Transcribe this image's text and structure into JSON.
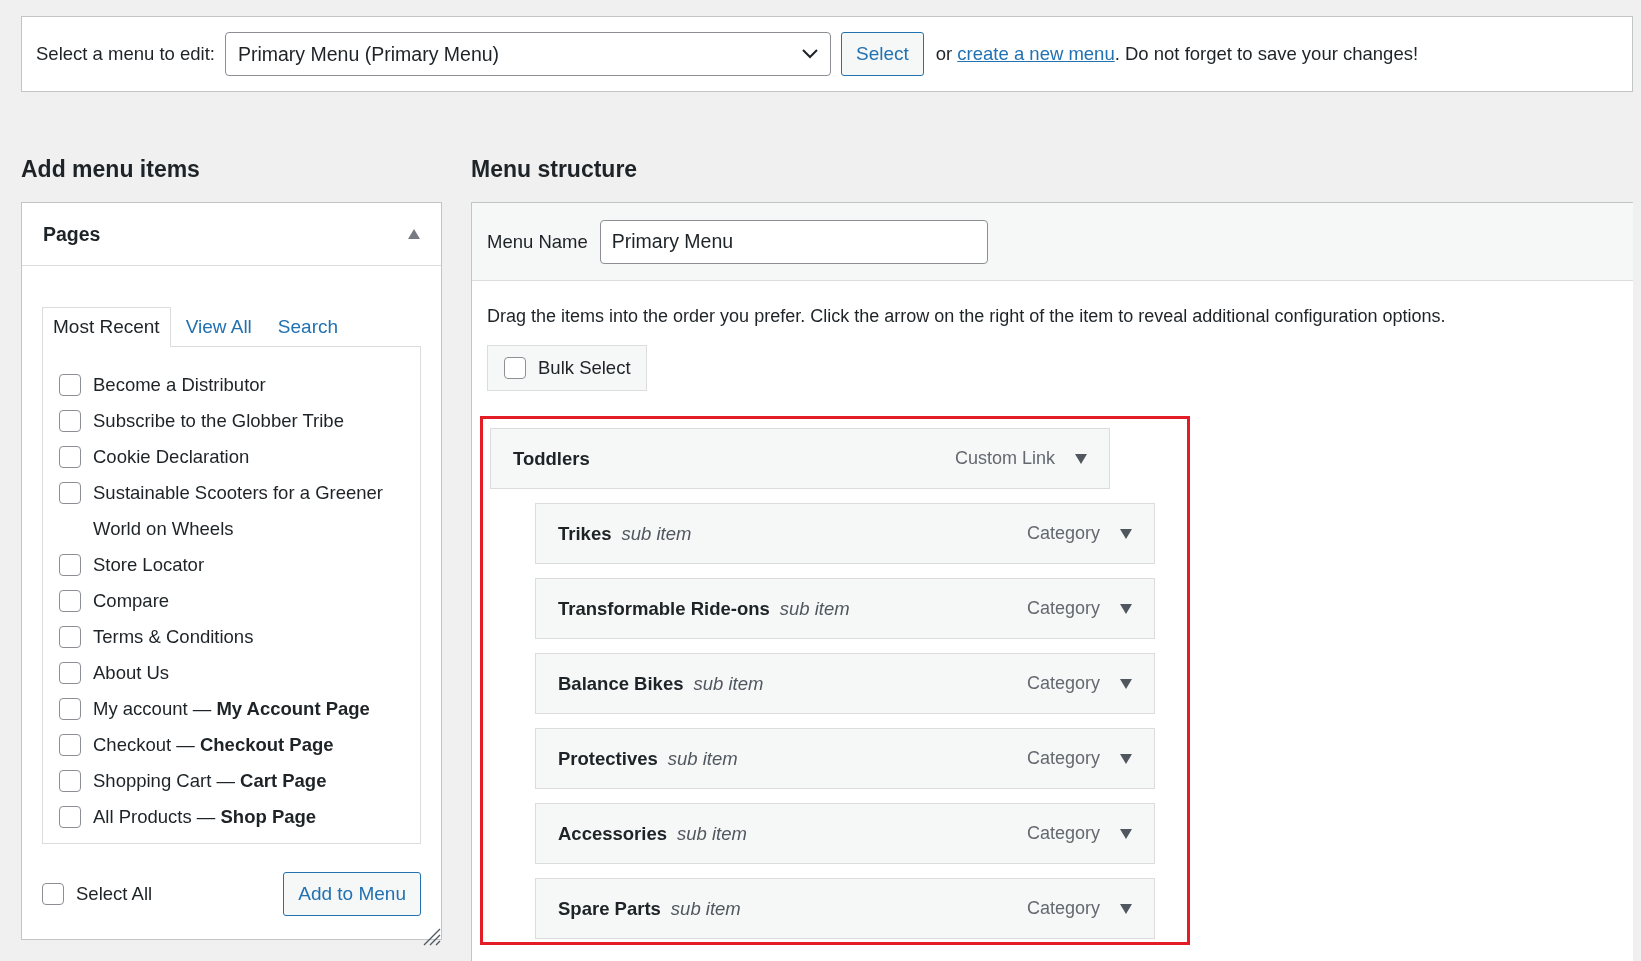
{
  "menu_select": {
    "label": "Select a menu to edit:",
    "value": "Primary Menu (Primary Menu)",
    "button": "Select",
    "note_before": "or",
    "link": "create a new menu",
    "note_after": ". Do not forget to save your changes!"
  },
  "add_items": {
    "heading": "Add menu items",
    "panel": {
      "title": "Pages",
      "expanded": true,
      "tabs": [
        {
          "label": "Most Recent",
          "selected": true
        },
        {
          "label": "View All",
          "selected": false
        },
        {
          "label": "Search",
          "selected": false
        }
      ],
      "pages": [
        {
          "label": "Become a Distributor",
          "checked": false
        },
        {
          "label": "Subscribe to the Globber Tribe",
          "checked": false
        },
        {
          "label": "Cookie Declaration",
          "checked": false
        },
        {
          "label": "Sustainable Scooters for a Greener World on Wheels",
          "checked": false
        },
        {
          "label": "Store Locator",
          "checked": false
        },
        {
          "label": "Compare",
          "checked": false
        },
        {
          "label": "Terms & Conditions",
          "checked": false
        },
        {
          "label": "About Us",
          "checked": false
        },
        {
          "label": "My account — **My Account Page**",
          "checked": false
        },
        {
          "label": "Checkout — **Checkout Page**",
          "checked": false
        },
        {
          "label": "Shopping Cart — **Cart Page**",
          "checked": false
        },
        {
          "label": "All Products — **Shop Page**",
          "checked": false
        }
      ],
      "select_all": {
        "label": "Select All",
        "checked": false
      },
      "add_button": "Add to Menu"
    }
  },
  "menu_structure": {
    "heading": "Menu structure",
    "name_label": "Menu Name",
    "name_value": "Primary Menu",
    "instructions": "Drag the items into the order you prefer. Click the arrow on the right of the item to reveal additional configuration options.",
    "bulk_select": {
      "label": "Bulk Select",
      "checked": false
    },
    "items": [
      {
        "title": "Toddlers",
        "type": "Custom Link",
        "children": [
          {
            "title": "Trikes",
            "note": "sub item",
            "type": "Category"
          },
          {
            "title": "Transformable Ride-ons",
            "note": "sub item",
            "type": "Category"
          },
          {
            "title": "Balance Bikes",
            "note": "sub item",
            "type": "Category"
          },
          {
            "title": "Protectives",
            "note": "sub item",
            "type": "Category"
          },
          {
            "title": "Accessories",
            "note": "sub item",
            "type": "Category"
          },
          {
            "title": "Spare Parts",
            "note": "sub item",
            "type": "Category"
          }
        ]
      }
    ]
  }
}
